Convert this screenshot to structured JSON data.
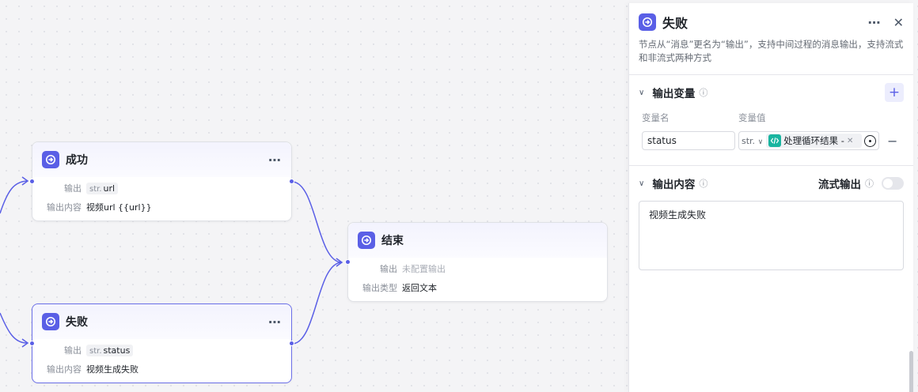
{
  "nodes": {
    "success": {
      "title": "成功",
      "output_label": "输出",
      "output_type": "str.",
      "output_var": "url",
      "content_label": "输出内容",
      "content_value": "视频url {{url}}"
    },
    "fail": {
      "title": "失败",
      "output_label": "输出",
      "output_type": "str.",
      "output_var": "status",
      "content_label": "输出内容",
      "content_value": "视频生成失败"
    },
    "end": {
      "title": "结束",
      "output_label": "输出",
      "output_value": "未配置输出",
      "type_label": "输出类型",
      "type_value": "返回文本"
    },
    "more_icon": "⋯"
  },
  "panel": {
    "title": "失败",
    "more_icon": "⋯",
    "close_icon": "✕",
    "description": "节点从“消息”更名为“输出”，支持中间过程的消息输出，支持流式和非流式两种方式",
    "output_vars": {
      "title": "输出变量",
      "col_name": "变量名",
      "col_value": "变量值",
      "add_icon": "+",
      "rows": [
        {
          "name": "status",
          "type": "str.",
          "ref": "处理循环结果 -",
          "remove": "−"
        }
      ]
    },
    "output_content": {
      "title": "输出内容",
      "stream_label": "流式输出",
      "stream_enabled": false,
      "value": "视频生成失败"
    },
    "info_icon": "ⓘ",
    "chevron_icon": "∨",
    "dropdown_icon": "∨"
  },
  "colors": {
    "accent": "#5a5fe6",
    "ref_icon": "#19b5a0",
    "edge": "#5a5fe6"
  }
}
